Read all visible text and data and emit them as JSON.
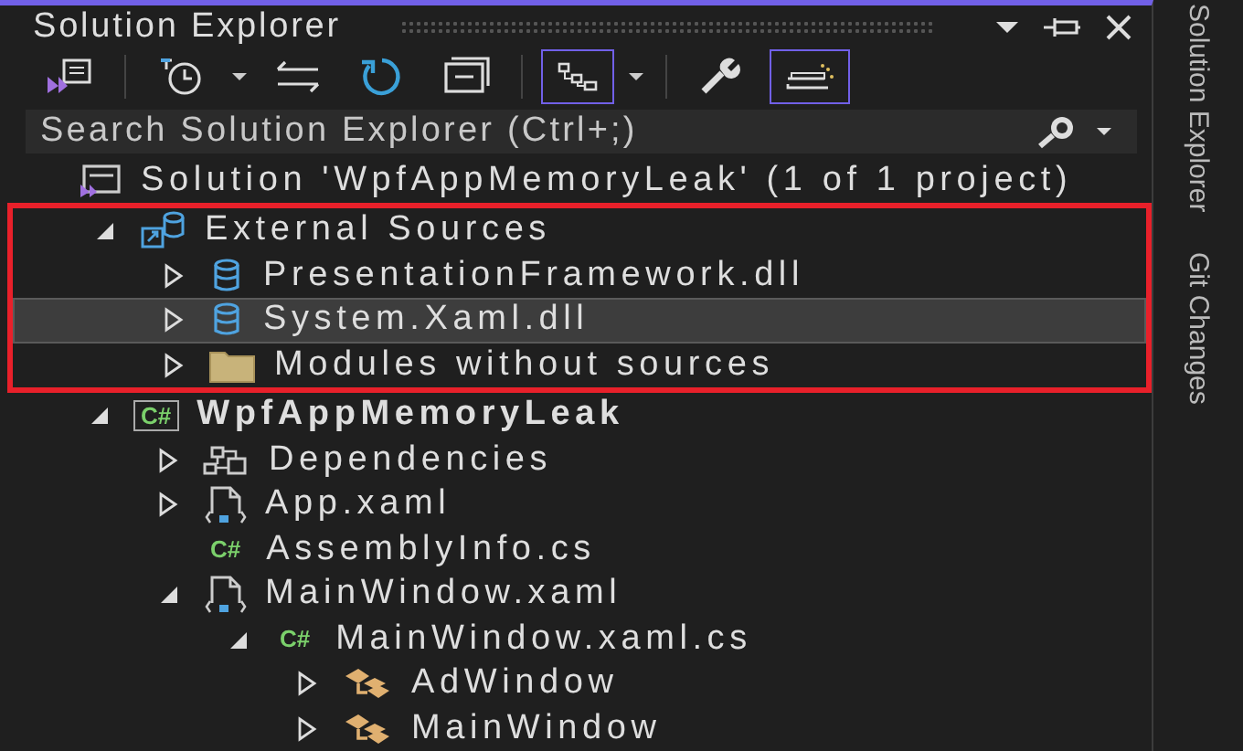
{
  "panel": {
    "title": "Solution Explorer"
  },
  "toolbar": [
    {
      "kind": "switch-views",
      "on": false
    },
    {
      "kind": "history",
      "on": false
    },
    {
      "kind": "dropdown",
      "on": false
    },
    {
      "kind": "sync",
      "on": false
    },
    {
      "kind": "refresh",
      "on": false
    },
    {
      "kind": "collapse",
      "on": false
    },
    {
      "kind": "tree-view",
      "on": true
    },
    {
      "kind": "dropdown",
      "on": false
    },
    {
      "kind": "properties",
      "on": false
    },
    {
      "kind": "preview",
      "on": true
    }
  ],
  "search": {
    "placeholder": "Search Solution Explorer (Ctrl+;)"
  },
  "tree": [
    {
      "name": "Solution 'WpfAppMemoryLeak' (1 of 1 project)",
      "kind": "solution",
      "selected": false,
      "children": [
        {
          "name": "External Sources",
          "kind": "external",
          "expanded": true,
          "selected": false,
          "highlighted": true,
          "children": [
            {
              "name": "PresentationFramework.dll",
              "kind": "assembly",
              "expanded": false,
              "selected": false
            },
            {
              "name": "System.Xaml.dll",
              "kind": "assembly",
              "expanded": false,
              "selected": true
            },
            {
              "name": "Modules without sources",
              "kind": "folder",
              "expanded": false,
              "selected": false
            }
          ]
        },
        {
          "name": "WpfAppMemoryLeak",
          "kind": "project",
          "icon_label": "C#",
          "bold": true,
          "expanded": true,
          "selected": false,
          "highlighted": false,
          "children": [
            {
              "name": "Dependencies",
              "kind": "dependencies",
              "expanded": false,
              "selected": false
            },
            {
              "name": "App.xaml",
              "kind": "xaml",
              "expanded": false,
              "selected": false
            },
            {
              "name": "AssemblyInfo.cs",
              "kind": "csharp",
              "icon_label": "C#",
              "selected": false
            },
            {
              "name": "MainWindow.xaml",
              "kind": "xaml",
              "expanded": true,
              "selected": false,
              "children": [
                {
                  "name": "MainWindow.xaml.cs",
                  "kind": "csharp",
                  "icon_label": "C#",
                  "expanded": true,
                  "selected": false,
                  "children": [
                    {
                      "name": "AdWindow",
                      "kind": "class",
                      "expanded": false,
                      "selected": false
                    },
                    {
                      "name": "MainWindow",
                      "kind": "class",
                      "expanded": false,
                      "selected": false
                    }
                  ]
                }
              ]
            }
          ]
        }
      ]
    }
  ],
  "side_tabs": [
    {
      "label": "Solution Explorer"
    },
    {
      "label": "Git Changes"
    }
  ]
}
